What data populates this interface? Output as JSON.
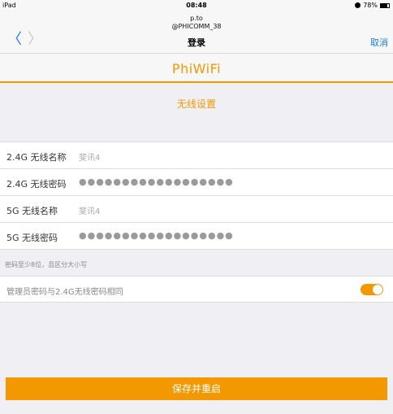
{
  "status_bar": {
    "carrier": "iPad",
    "time": "08:48",
    "battery": "78%"
  },
  "nav": {
    "url_line1": "p.to",
    "url_line2": "@PHICOMM_38",
    "title": "登录",
    "cancel_label": "取消",
    "back_symbol": "〈",
    "forward_symbol": "〉"
  },
  "brand": {
    "logo_text": "PhiWiFi",
    "accent_color": "#f39800"
  },
  "section_title": "无线设置",
  "form": {
    "rows": [
      {
        "label": "2.4G 无线名称",
        "value": "斐讯4"
      },
      {
        "label": "2.4G 无线密码",
        "value": "●●●●●●●●●●●●●●●●●●"
      },
      {
        "label": "5G 无线名称",
        "value": "斐讯4"
      },
      {
        "label": "5G 无线密码",
        "value": "●●●●●●●●●●●●●●●●●●"
      }
    ]
  },
  "hint": "密码至少8位，且区分大小写",
  "toggle": {
    "label": "管理员密码与2.4G无线密码相同",
    "on": true
  },
  "save_button_label": "保存并重启"
}
